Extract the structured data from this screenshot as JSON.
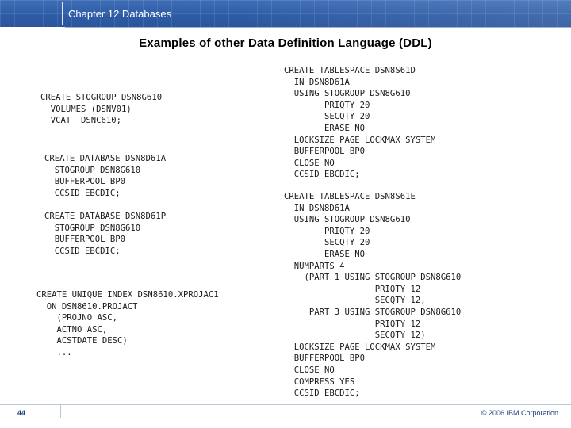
{
  "header": {
    "chapter_title": "Chapter 12 Databases",
    "accent_color": "#2e5ca6"
  },
  "slide": {
    "title": "Examples of other Data Definition Language (DDL)"
  },
  "code_blocks": {
    "stogroup": "CREATE STOGROUP DSN8G610\n  VOLUMES (DSNV01)\n  VCAT  DSNC610;",
    "database_1": "CREATE DATABASE DSN8D61A\n  STOGROUP DSN8G610\n  BUFFERPOOL BP0\n  CCSID EBCDIC;",
    "database_2": "CREATE DATABASE DSN8D61P\n  STOGROUP DSN8G610\n  BUFFERPOOL BP0\n  CCSID EBCDIC;",
    "index": "CREATE UNIQUE INDEX DSN8610.XPROJAC1\n  ON DSN8610.PROJACT\n    (PROJNO ASC,\n    ACTNO ASC,\n    ACSTDATE DESC)\n    ...",
    "tablespace_1": "CREATE TABLESPACE DSN8S61D\n  IN DSN8D61A\n  USING STOGROUP DSN8G610\n        PRIQTY 20\n        SECQTY 20\n        ERASE NO\n  LOCKSIZE PAGE LOCKMAX SYSTEM\n  BUFFERPOOL BP0\n  CLOSE NO\n  CCSID EBCDIC;",
    "tablespace_2": "CREATE TABLESPACE DSN8S61E\n  IN DSN8D61A\n  USING STOGROUP DSN8G610\n        PRIQTY 20\n        SECQTY 20\n        ERASE NO\n  NUMPARTS 4\n    (PART 1 USING STOGROUP DSN8G610\n                  PRIQTY 12\n                  SECQTY 12,\n     PART 3 USING STOGROUP DSN8G610\n                  PRIQTY 12\n                  SECQTY 12)\n  LOCKSIZE PAGE LOCKMAX SYSTEM\n  BUFFERPOOL BP0\n  CLOSE NO\n  COMPRESS YES\n  CCSID EBCDIC;"
  },
  "footer": {
    "page_number": "44",
    "copyright": "© 2006 IBM Corporation"
  }
}
